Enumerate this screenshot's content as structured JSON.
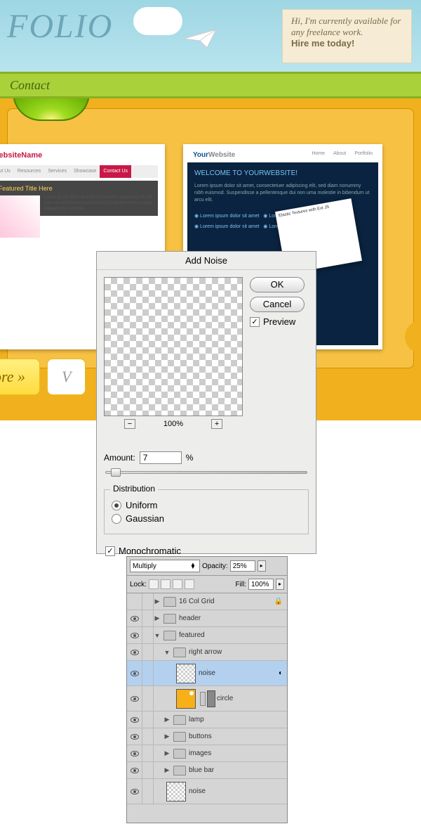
{
  "header": {
    "logo": "FOLIO",
    "sticky_text": "Hi, I'm currently available for any freelance work.",
    "sticky_cta": "Hire me today!"
  },
  "nav": {
    "item": "Contact"
  },
  "gallery": {
    "thumb1": {
      "site_name": "r WebsiteName",
      "tabs": [
        "About Us",
        "Resources",
        "Services",
        "Showcase",
        "Contact Us"
      ],
      "featured_title": "★ Featured Title Here",
      "button_more": "ore »",
      "button_v": "V"
    },
    "thumb2": {
      "site_name_a": "Your",
      "site_name_b": "Website",
      "nav": [
        "Home",
        "About",
        "Portfolio"
      ],
      "welcome_a": "WELCOME TO ",
      "welcome_b": "YOURWEBSITE!",
      "tile_text": "Elastic Textures with Ext JS"
    }
  },
  "dialog": {
    "title": "Add Noise",
    "ok": "OK",
    "cancel": "Cancel",
    "preview_label": "Preview",
    "preview_checked": true,
    "zoom": "100%",
    "zoom_out": "−",
    "zoom_in": "+",
    "amount_label": "Amount:",
    "amount_value": "7",
    "amount_unit": "%",
    "distribution_legend": "Distribution",
    "uniform": "Uniform",
    "gaussian": "Gaussian",
    "monochromatic": "Monochromatic",
    "mono_checked": true
  },
  "layers": {
    "blend_mode": "Multiply",
    "opacity_label": "Opacity:",
    "opacity": "25%",
    "lock_label": "Lock:",
    "fill_label": "Fill:",
    "fill": "100%",
    "items": [
      {
        "name": "16 Col Grid",
        "type": "folder",
        "indent": 0,
        "eye": false,
        "arrow": "▶"
      },
      {
        "name": "header",
        "type": "folder",
        "indent": 0,
        "eye": true,
        "arrow": "▶"
      },
      {
        "name": "featured",
        "type": "folder",
        "indent": 0,
        "eye": true,
        "arrow": "▼"
      },
      {
        "name": "right arrow",
        "type": "folder",
        "indent": 1,
        "eye": true,
        "arrow": "▼"
      },
      {
        "name": "noise",
        "type": "layer",
        "indent": 2,
        "eye": true,
        "thumb": "noise",
        "selected": true
      },
      {
        "name": "circle",
        "type": "layer",
        "indent": 2,
        "eye": true,
        "thumb": "circle"
      },
      {
        "name": "lamp",
        "type": "folder",
        "indent": 1,
        "eye": true,
        "arrow": "▶"
      },
      {
        "name": "buttons",
        "type": "folder",
        "indent": 1,
        "eye": true,
        "arrow": "▶"
      },
      {
        "name": "images",
        "type": "folder",
        "indent": 1,
        "eye": true,
        "arrow": "▶"
      },
      {
        "name": "blue bar",
        "type": "folder",
        "indent": 1,
        "eye": true,
        "arrow": "▶"
      },
      {
        "name": "noise",
        "type": "layer",
        "indent": 1,
        "eye": true,
        "thumb": "noise"
      }
    ]
  }
}
